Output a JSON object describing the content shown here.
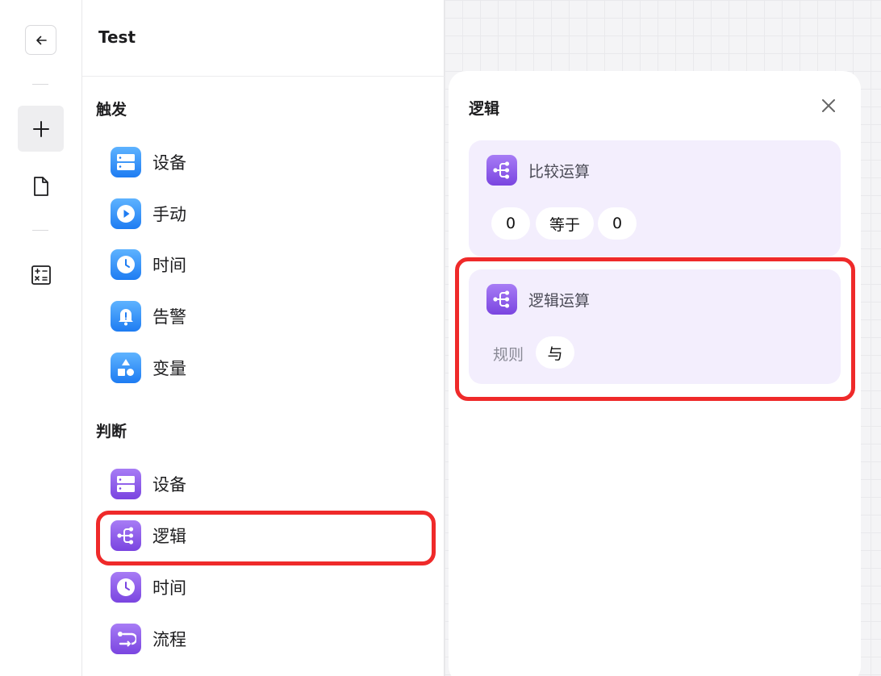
{
  "app": {
    "title": "Test"
  },
  "rail": {
    "back_icon": "arrow-left-icon",
    "add_icon": "plus-icon",
    "doc_icon": "document-icon",
    "calc_icon": "calculator-icon"
  },
  "menu": {
    "sections": [
      {
        "label": "触发",
        "color": "blue",
        "items": [
          {
            "label": "设备",
            "icon": "device-icon"
          },
          {
            "label": "手动",
            "icon": "play-icon"
          },
          {
            "label": "时间",
            "icon": "clock-icon"
          },
          {
            "label": "告警",
            "icon": "bell-icon"
          },
          {
            "label": "变量",
            "icon": "shapes-icon"
          }
        ]
      },
      {
        "label": "判断",
        "color": "purple",
        "items": [
          {
            "label": "设备",
            "icon": "device-icon"
          },
          {
            "label": "逻辑",
            "icon": "logic-icon"
          },
          {
            "label": "时间",
            "icon": "clock-icon"
          },
          {
            "label": "流程",
            "icon": "flow-icon"
          }
        ]
      }
    ]
  },
  "panel": {
    "title": "逻辑",
    "close_icon": "close-icon",
    "cards": {
      "compare": {
        "name": "比较运算",
        "left": "0",
        "op": "等于",
        "right": "0"
      },
      "logic": {
        "name": "逻辑运算",
        "rule_label": "规则",
        "rule_value": "与"
      }
    }
  },
  "colors": {
    "blue_accent": "#1e7cf2",
    "purple_accent": "#7a45e0",
    "card_bg": "#f3eefd",
    "highlight": "#ef2a2a"
  }
}
